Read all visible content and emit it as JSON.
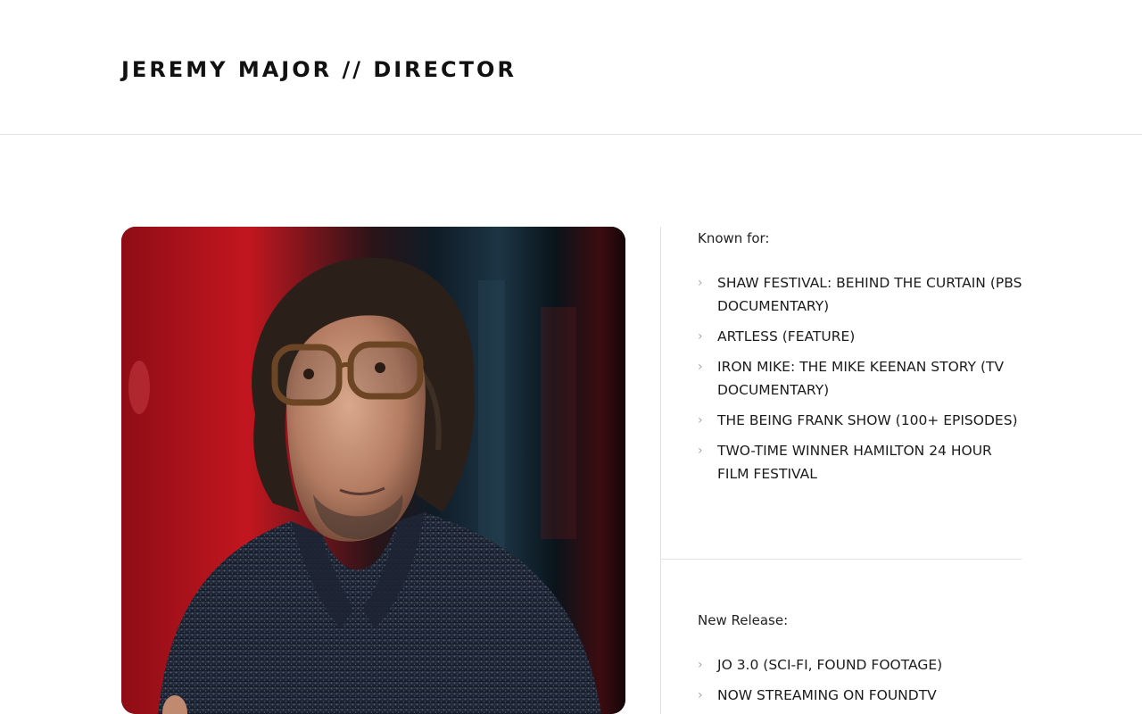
{
  "header": {
    "site_title": "JEREMY MAJOR // DIRECTOR"
  },
  "portrait": {
    "alt": "Portrait of Jeremy Major wearing glasses and a dark knit sweater against a red and dark blue background"
  },
  "known_for": {
    "label": "Known for:",
    "items": [
      "SHAW FESTIVAL: BEHIND THE CURTAIN (PBS DOCUMENTARY)",
      "ARTLESS (FEATURE)",
      "IRON MIKE: THE MIKE KEENAN STORY (TV DOCUMENTARY)",
      "THE BEING FRANK SHOW (100+ EPISODES)",
      "TWO-TIME WINNER HAMILTON 24 HOUR FILM FESTIVAL"
    ]
  },
  "new_release": {
    "label": "New Release:",
    "items": [
      "JO 3.0 (SCI-FI, FOUND FOOTAGE)",
      "NOW STREAMING ON FOUNDTV"
    ]
  },
  "icons": {
    "list_bullet": "chevron-right-icon",
    "list_bullet_glyph": "›"
  },
  "colors": {
    "background": "#ffffff",
    "text": "#1a1a1a",
    "divider": "#e2e2e2",
    "bullet": "#a9a9a9",
    "portrait_red": "#b3141c",
    "portrait_dark": "#0c1720"
  }
}
